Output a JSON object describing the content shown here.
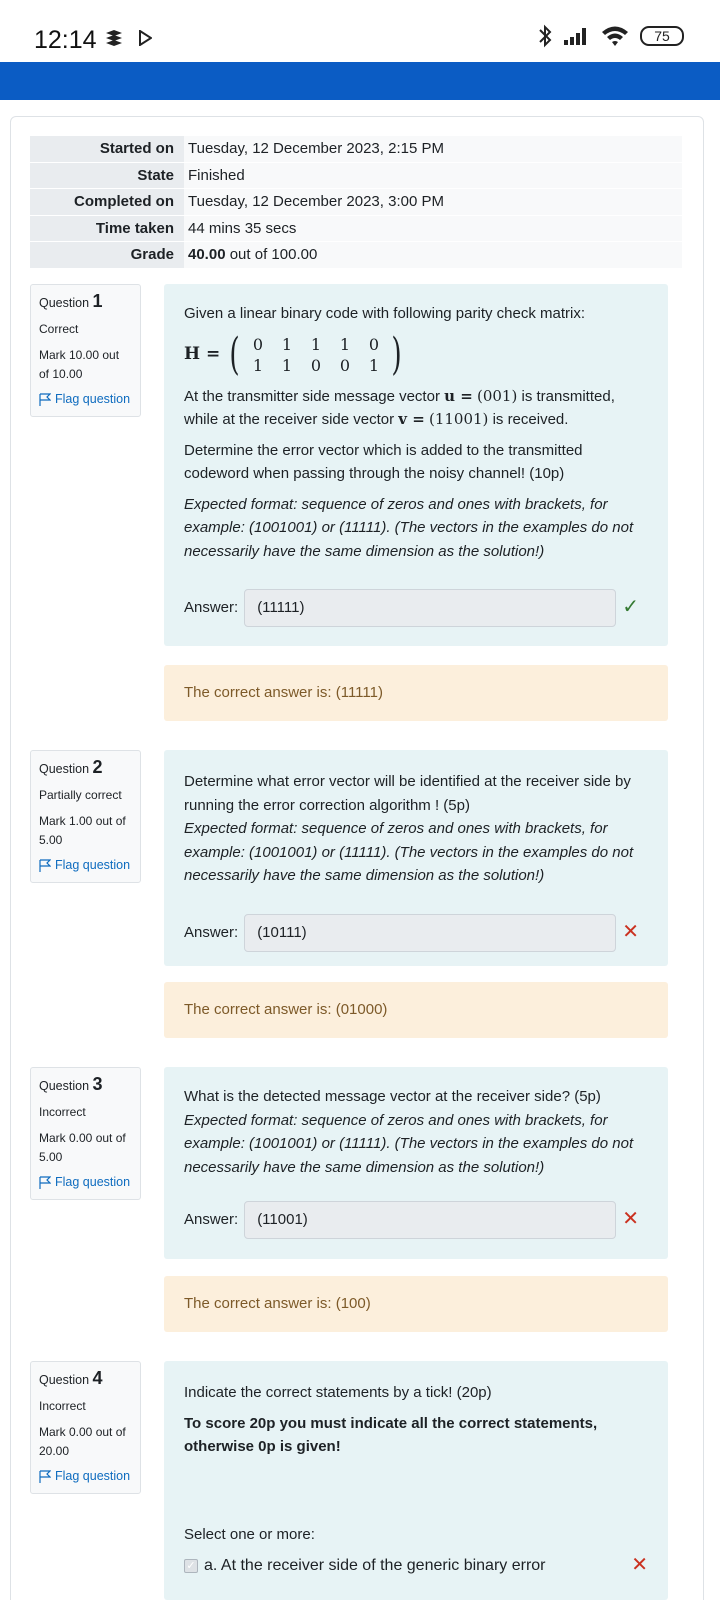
{
  "status_bar": {
    "time": "12:14",
    "battery": "75"
  },
  "summary": [
    {
      "label": "Started on",
      "value": "Tuesday, 12 December 2023, 2:15 PM"
    },
    {
      "label": "State",
      "value": "Finished"
    },
    {
      "label": "Completed on",
      "value": "Tuesday, 12 December 2023, 3:00 PM"
    },
    {
      "label": "Time taken",
      "value": "44 mins 35 secs"
    },
    {
      "label": "Grade",
      "value_bold": "40.00",
      "value_rest": " out of 100.00"
    }
  ],
  "questions": [
    {
      "label": "Question",
      "number": "1",
      "state": "Correct",
      "mark": "Mark 10.00 out of 10.00",
      "flag": "Flag question",
      "intro": "Given a linear binary code with following parity check matrix:",
      "matrix_label": "H =",
      "matrix": [
        "0",
        "1",
        "1",
        "1",
        "0",
        "1",
        "1",
        "0",
        "0",
        "1"
      ],
      "tx_text": "At the transmitter side message vector",
      "u_sym": "u =",
      "u_val": "(001)",
      "tx_mid": "is transmitted, while at the receiver side vector",
      "v_sym": "v =",
      "v_val": "(11001)",
      "tx_end": "is received.",
      "task": "Determine the error vector which is added to the transmitted codeword when passing through the noisy channel! (10p)",
      "format": "Expected format: sequence of zeros and ones with brackets, for example: (1001001) or (11111). (The vectors in the examples do not necessarily have the same dimension as the solution!)",
      "answer_label": "Answer:",
      "answer": "(11111)",
      "feedback": "The correct answer is: (11111)"
    },
    {
      "label": "Question",
      "number": "2",
      "state": "Partially correct",
      "mark": "Mark 1.00 out of 5.00",
      "flag": "Flag question",
      "task": "Determine what error vector will be identified at the receiver side by running the error correction algorithm ! (5p)",
      "format": "Expected format: sequence of zeros and ones with brackets, for example: (1001001) or (11111). (The vectors in the examples do not necessarily have the same dimension as the solution!)",
      "answer_label": "Answer:",
      "answer": "(10111)",
      "feedback": "The correct answer is: (01000)"
    },
    {
      "label": "Question",
      "number": "3",
      "state": "Incorrect",
      "mark": "Mark 0.00 out of 5.00",
      "flag": "Flag question",
      "task": "What is the detected message vector at the receiver side? (5p)",
      "format": "Expected format: sequence of zeros and ones with brackets, for example: (1001001) or (11111). (The vectors in the examples do not necessarily have the same dimension as the solution!)",
      "answer_label": "Answer:",
      "answer": "(11001)",
      "feedback": "The correct answer is: (100)"
    },
    {
      "label": "Question",
      "number": "4",
      "state": "Incorrect",
      "mark": "Mark 0.00 out of 20.00",
      "flag": "Flag question",
      "task": "Indicate the correct statements by a tick! (20p)",
      "bold_note": "To score 20p you must indicate all the correct statements, otherwise 0p is given!",
      "select_label": "Select one or more:",
      "option_a": "a. At the receiver side of the generic binary error"
    }
  ]
}
